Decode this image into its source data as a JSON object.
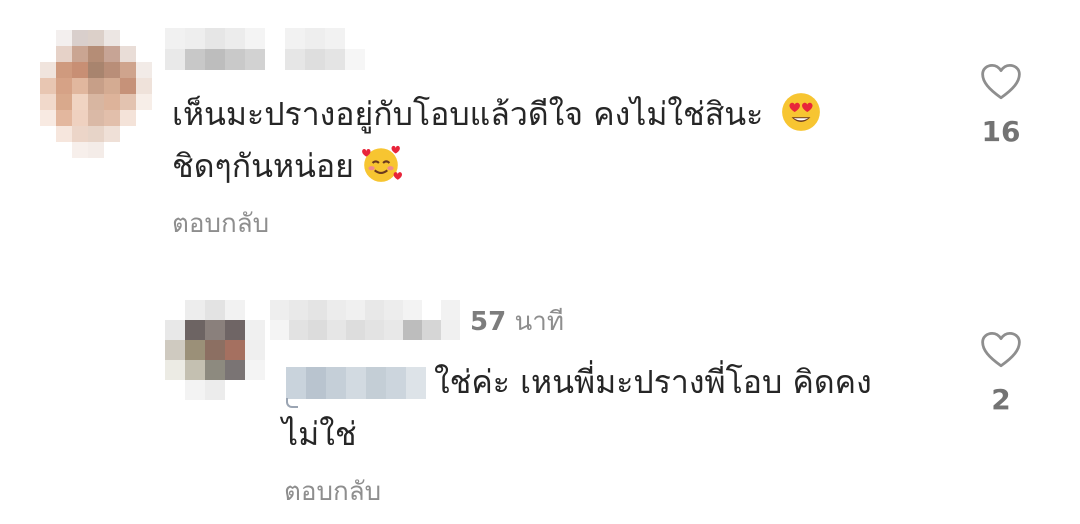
{
  "comments": [
    {
      "text": "เห็นมะปรางอยู่กับโอบแล้วดีใจ คงไม่ใช่สินะ",
      "text_line2": "ชิดๆกันหน่อย",
      "emojis": [
        "heart-eyes-emoji",
        "smiling-face-with-hearts-emoji"
      ],
      "reply_label": "ตอบกลับ",
      "likes": "16"
    }
  ],
  "replies": [
    {
      "time_num": "57",
      "time_unit": "นาที",
      "text": "ใช่ค่ะ เหนพี่มะปรางพี่โอบ คิดคง",
      "text_line2": "ไม่ใช่",
      "reply_label": "ตอบกลับ",
      "likes": "2"
    }
  ],
  "icons": {
    "like": "heart-outline-icon"
  },
  "colors": {
    "text": "#262626",
    "secondary": "#8e8e8e",
    "like_count": "#737373",
    "heart_stroke": "#8e8e8e"
  }
}
